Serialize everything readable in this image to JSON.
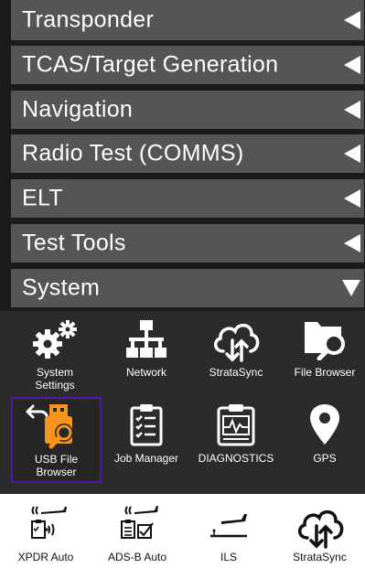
{
  "menu": {
    "items": [
      {
        "label": "Transponder",
        "state": "collapsed"
      },
      {
        "label": "TCAS/Target Generation",
        "state": "collapsed"
      },
      {
        "label": "Navigation",
        "state": "collapsed"
      },
      {
        "label": "Radio Test (COMMS)",
        "state": "collapsed"
      },
      {
        "label": "ELT",
        "state": "collapsed"
      },
      {
        "label": "Test Tools",
        "state": "collapsed"
      },
      {
        "label": "System",
        "state": "expanded"
      }
    ]
  },
  "apps": {
    "row1": [
      {
        "label": "System\nSettings",
        "icon": "gears-icon"
      },
      {
        "label": "Network",
        "icon": "network-icon"
      },
      {
        "label": "StrataSync",
        "icon": "cloud-sync-icon"
      },
      {
        "label": "File Browser",
        "icon": "folder-search-icon"
      }
    ],
    "row2": [
      {
        "label": "USB File\nBrowser",
        "icon": "usb-search-icon",
        "selected": true
      },
      {
        "label": "Job Manager",
        "icon": "clipboard-icon"
      },
      {
        "label": "DIAGNOSTICS",
        "icon": "diagnostics-icon"
      },
      {
        "label": "GPS",
        "icon": "location-pin-icon"
      }
    ]
  },
  "dock": [
    {
      "label": "XPDR Auto",
      "icon": "xpdr-auto-icon"
    },
    {
      "label": "ADS-B Auto",
      "icon": "adsb-auto-icon"
    },
    {
      "label": "ILS",
      "icon": "ils-icon"
    },
    {
      "label": "StrataSync",
      "icon": "stratasync-icon"
    }
  ],
  "colors": {
    "menu_bg": "#555555",
    "background": "#1b1b1b",
    "apps_bg": "#2b2b2b",
    "accent_orange": "#f7941d",
    "selection_border": "#4a1aa8"
  }
}
